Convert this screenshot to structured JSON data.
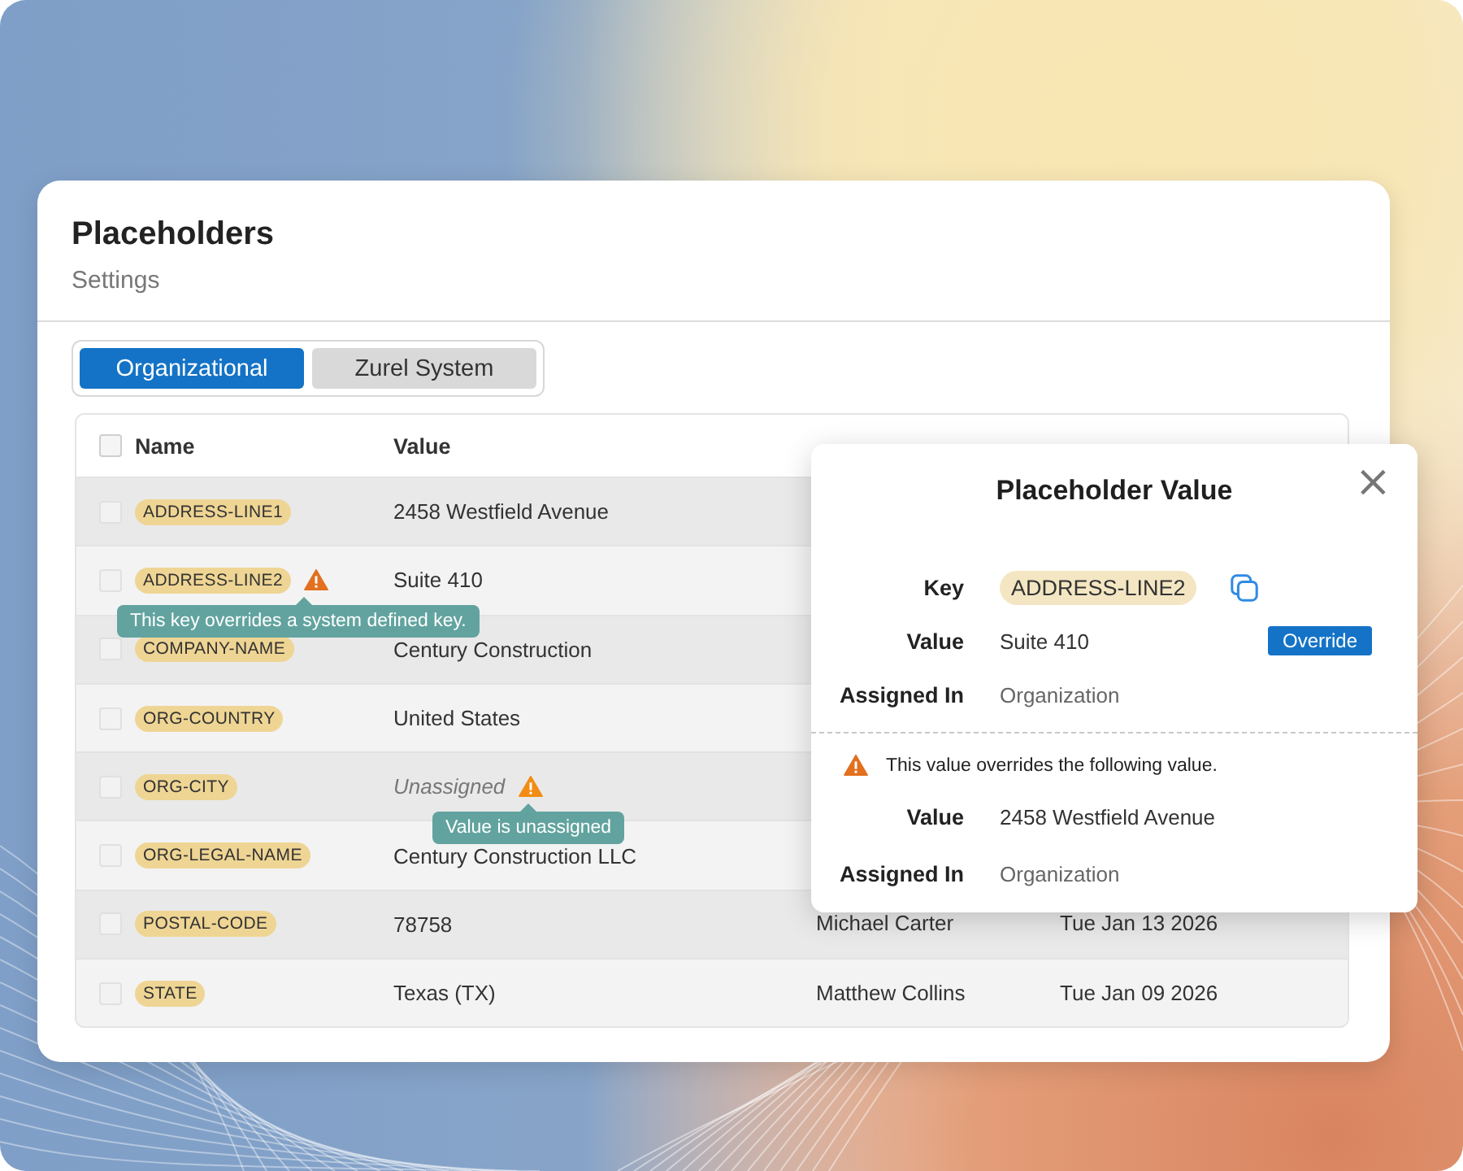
{
  "page": {
    "title": "Placeholders",
    "subtitle": "Settings"
  },
  "tabs": [
    {
      "label": "Organizational",
      "selected": true
    },
    {
      "label": "Zurel System",
      "selected": false
    }
  ],
  "table": {
    "select_all": {
      "checked": false
    },
    "columns": [
      "Name",
      "Value"
    ],
    "rows": [
      {
        "name": "ADDRESS-LINE1",
        "value": "2458 Westfield Avenue",
        "checked": false,
        "warning": false
      },
      {
        "name": "ADDRESS-LINE2",
        "value": "Suite 410",
        "checked": false,
        "warning": true,
        "tooltip": "This key overrides a system defined key."
      },
      {
        "name": "COMPANY-NAME",
        "value": "Century Construction",
        "checked": false,
        "warning": false
      },
      {
        "name": "ORG-COUNTRY",
        "value": "United States",
        "checked": false,
        "warning": false
      },
      {
        "name": "ORG-CITY",
        "value": "Unassigned",
        "unassigned": true,
        "checked": false,
        "warning": true,
        "tooltip": "Value is unassigned"
      },
      {
        "name": "ORG-LEGAL-NAME",
        "value": "Century Construction LLC",
        "checked": false,
        "warning": false
      },
      {
        "name": "POSTAL-CODE",
        "value": "78758",
        "checked": false,
        "warning": false,
        "modified_by": "Michael Carter",
        "modified_on": "Tue Jan 13 2026"
      },
      {
        "name": "STATE",
        "value": "Texas (TX)",
        "checked": false,
        "warning": false,
        "modified_by": "Matthew Collins",
        "modified_on": "Tue Jan 09 2026"
      }
    ]
  },
  "dialog": {
    "title": "Placeholder Value",
    "close": "×",
    "fields": [
      {
        "label": "Key",
        "value": "ADDRESS-LINE2",
        "kind": "key"
      },
      {
        "label": "Value",
        "value": "Suite 410",
        "kind": "value",
        "badge": "Override"
      },
      {
        "label": "Assigned In",
        "value": "Organization",
        "kind": "muted"
      }
    ],
    "notice": "This value overrides the following value.",
    "previous": [
      {
        "label": "Value",
        "value": "2458 Westfield Avenue",
        "kind": "value"
      },
      {
        "label": "Assigned In",
        "value": "Organization",
        "kind": "muted"
      }
    ]
  }
}
